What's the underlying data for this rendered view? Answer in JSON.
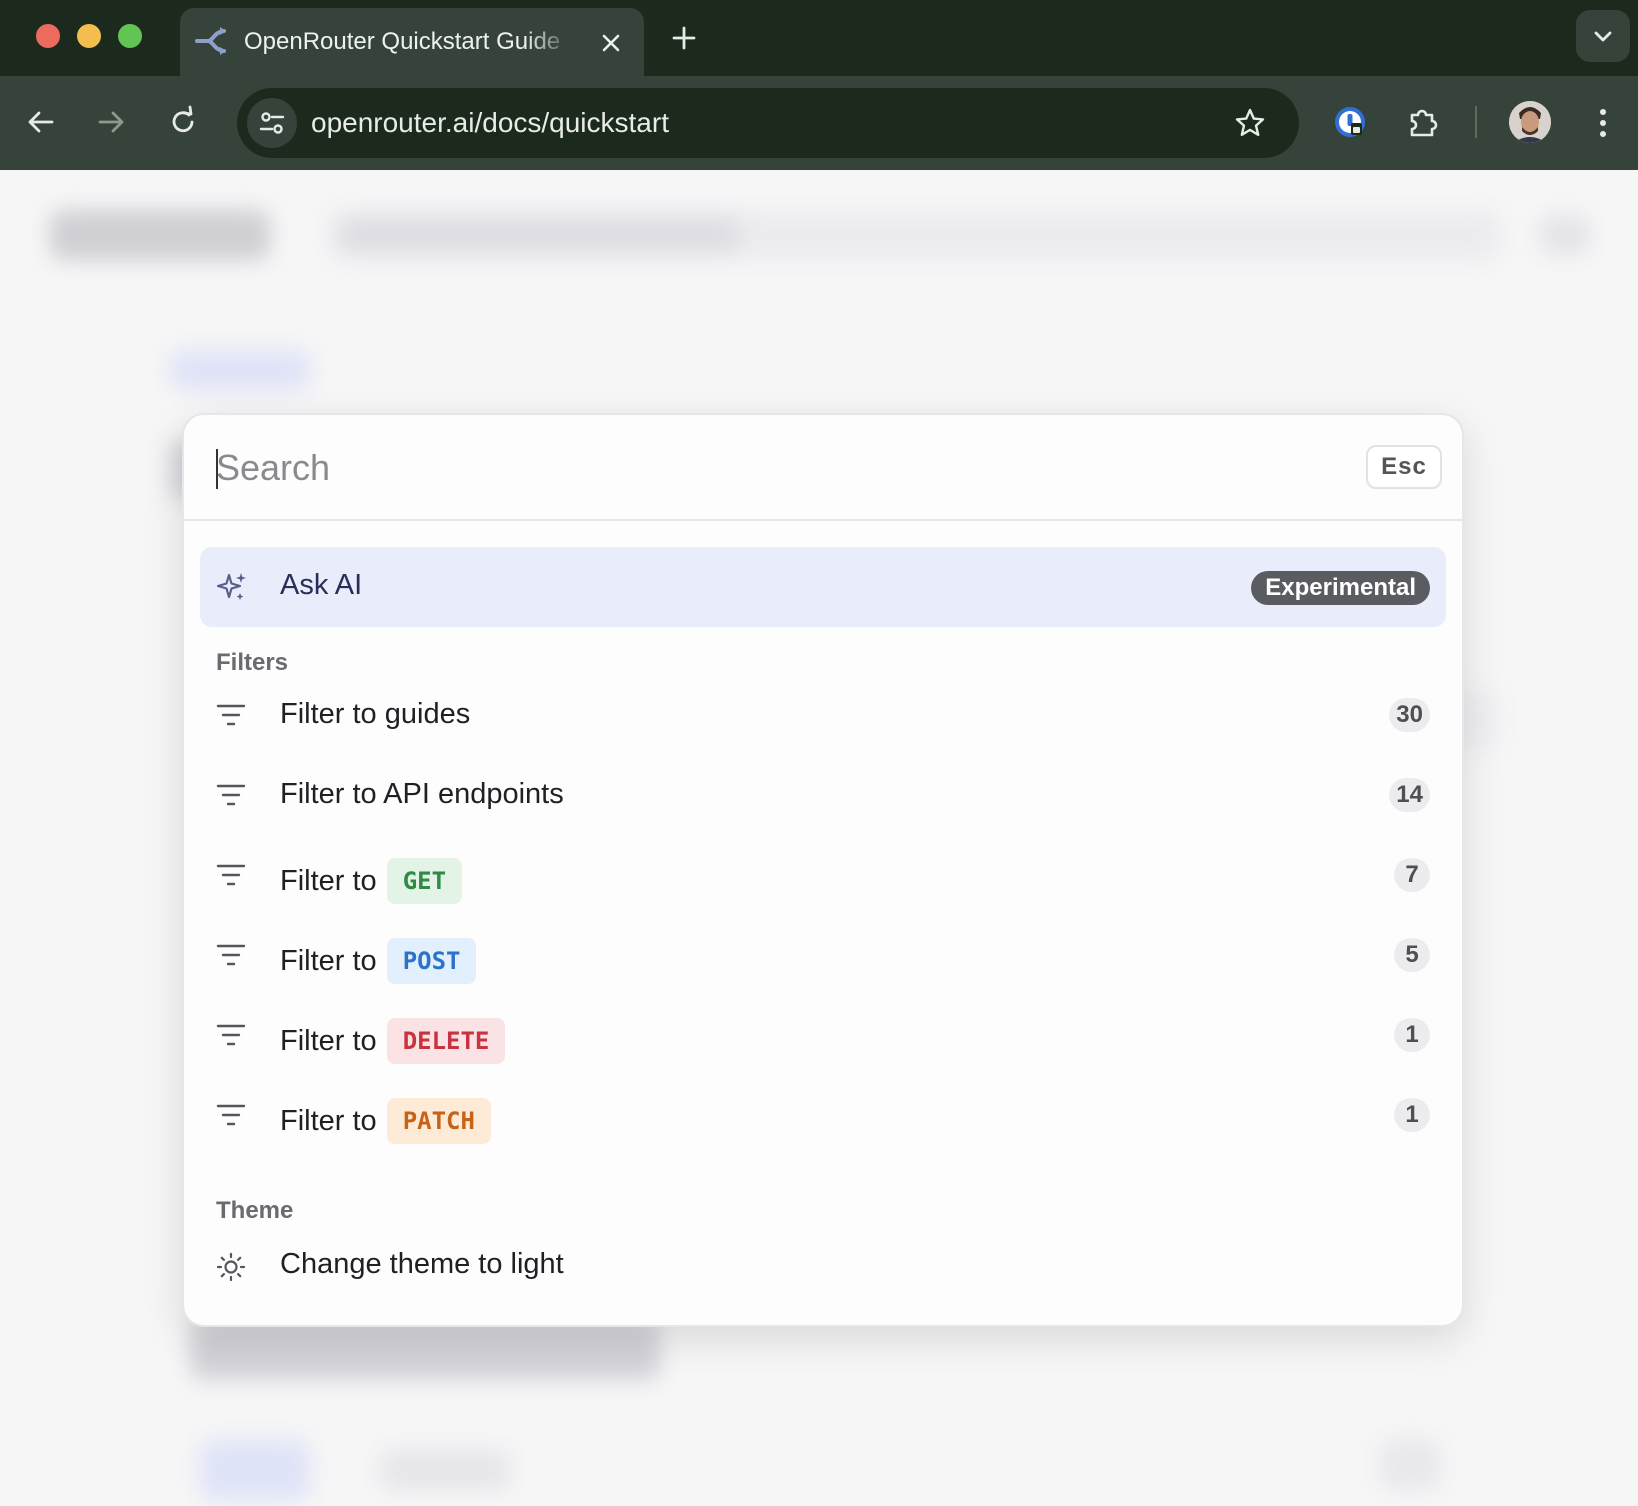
{
  "browser": {
    "tab_title": "OpenRouter Quickstart Guide",
    "url": "openrouter.ai/docs/quickstart",
    "colors": {
      "chrome_dark": "#1c2a1d",
      "chrome_mid": "#36433a"
    }
  },
  "search": {
    "placeholder": "Search",
    "esc_label": "Esc"
  },
  "ask_ai": {
    "label": "Ask AI",
    "badge": "Experimental",
    "icon": "sparkle-icon"
  },
  "filters": {
    "heading": "Filters",
    "items": [
      {
        "label": "Filter to guides",
        "count": "30"
      },
      {
        "label": "Filter to API endpoints",
        "count": "14"
      },
      {
        "label": "Filter to",
        "method": "GET",
        "count": "7",
        "color": "#2f8a48"
      },
      {
        "label": "Filter to",
        "method": "POST",
        "count": "5",
        "color": "#2d72c9"
      },
      {
        "label": "Filter to",
        "method": "DELETE",
        "count": "1",
        "color": "#c8333f"
      },
      {
        "label": "Filter to",
        "method": "PATCH",
        "count": "1",
        "color": "#c66316"
      }
    ]
  },
  "theme": {
    "heading": "Theme",
    "item_label": "Change theme to light",
    "icon": "sun-icon"
  }
}
